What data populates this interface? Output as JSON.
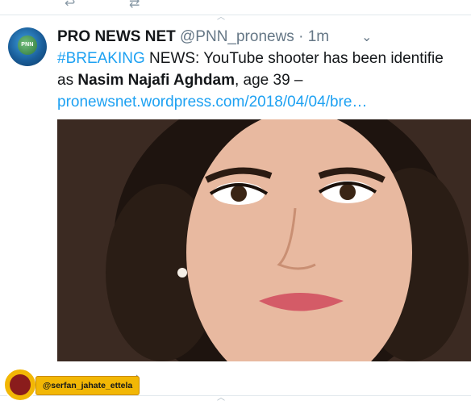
{
  "tweet": {
    "avatar_text": "PNN",
    "author_name": "PRO NEWS NET",
    "handle": "@PNN_pronews",
    "dot": "·",
    "time": "1m",
    "caret": "⌄",
    "text": {
      "hashtag": "#BREAKING",
      "line1_rest": " NEWS: YouTube shooter has been identifie",
      "line2_prefix": "as ",
      "line2_bold": "Nasim Najafi Aghdam",
      "line2_suffix": ", age 39 –",
      "link": "pronewsnet.wordpress.com/2018/04/04/bre…"
    }
  },
  "watermark": {
    "label": "@serfan_jahate_ettela"
  },
  "icons": {
    "reply": "↩",
    "retweet": "⇄",
    "chevron": "︿"
  }
}
